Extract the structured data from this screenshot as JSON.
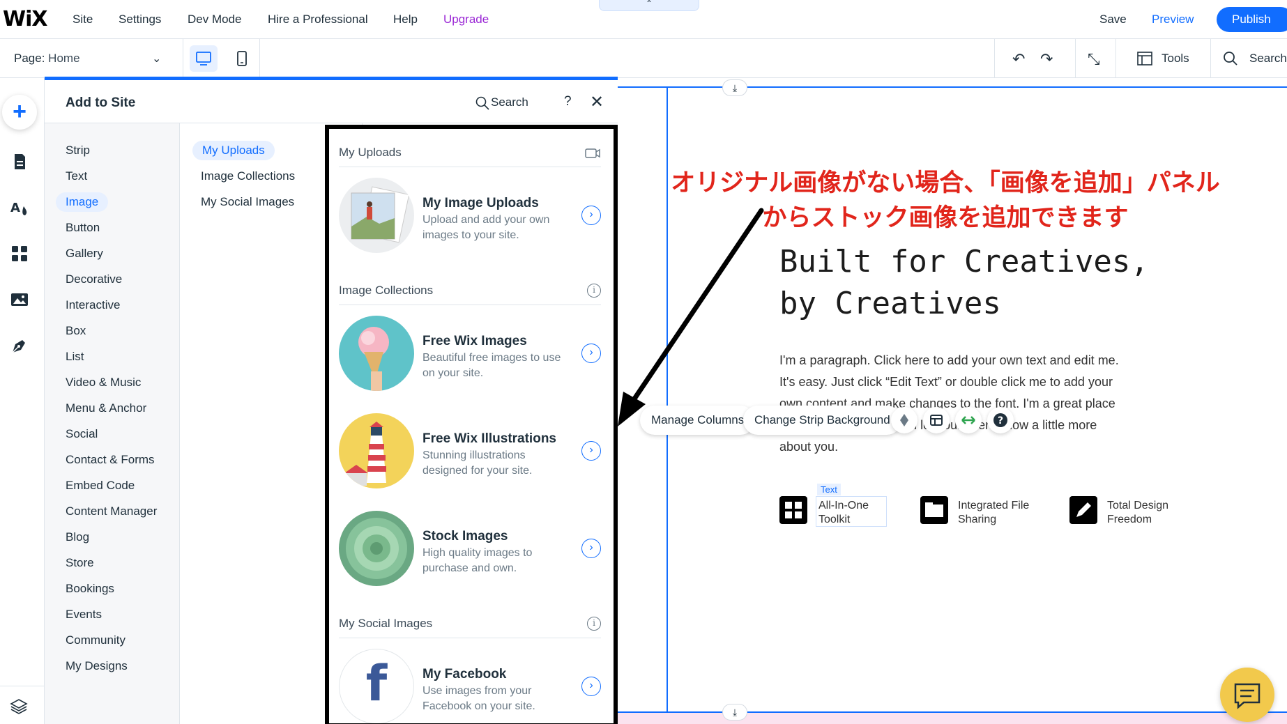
{
  "topbar": {
    "logo": "WiX",
    "nav": [
      {
        "label": "Site"
      },
      {
        "label": "Settings"
      },
      {
        "label": "Dev Mode"
      },
      {
        "label": "Hire a Professional"
      },
      {
        "label": "Help"
      },
      {
        "label": "Upgrade"
      }
    ],
    "collapse_glyph": "⌃",
    "save_label": "Save",
    "preview_label": "Preview",
    "publish_label": "Publish",
    "accent_color": "#116dff",
    "upgrade_color": "#9a27d5"
  },
  "subbar": {
    "page_prefix": "Page:",
    "page_value": "Home",
    "page_chevron": "⌄",
    "undo_glyph": "↶",
    "redo_glyph": "↷",
    "zoom_glyph": "⤡",
    "tools_label": "Tools",
    "search_label": "Search"
  },
  "panel": {
    "title": "Add to Site",
    "search_label": "Search",
    "help_glyph": "?",
    "close_glyph": "✕",
    "categories": [
      "Strip",
      "Text",
      "Image",
      "Button",
      "Gallery",
      "Decorative",
      "Interactive",
      "Box",
      "List",
      "Video & Music",
      "Menu & Anchor",
      "Social",
      "Contact & Forms",
      "Embed Code",
      "Content Manager",
      "Blog",
      "Store",
      "Bookings",
      "Events",
      "Community",
      "My Designs"
    ],
    "active_category": "Image",
    "subcategories": [
      "My Uploads",
      "Image Collections",
      "My Social Images"
    ],
    "sections": {
      "uploads_header": "My Uploads",
      "collections_header": "Image Collections",
      "social_header": "My Social Images",
      "info_glyph": "i"
    },
    "items": [
      {
        "title": "My Image Uploads",
        "desc": "Upload and add your own images to your site."
      },
      {
        "title": "Free Wix Images",
        "desc": "Beautiful free images to use on your site."
      },
      {
        "title": "Free Wix Illustrations",
        "desc": "Stunning illustrations designed for your site."
      },
      {
        "title": "Stock Images",
        "desc": "High quality images to purchase and own."
      },
      {
        "title": "My Facebook",
        "desc": "Use images from your Facebook on your site."
      }
    ],
    "go_glyph": "›",
    "facebook_letter": "f"
  },
  "canvas": {
    "annotation": "オリジナル画像がない場合、「画像を追加」パネルからストック画像を追加できます",
    "annotation_color": "#e1251b",
    "hero_line1": "Built for Creatives,",
    "hero_line2": "by Creatives",
    "paragraph": "I'm a paragraph. Click here to add your own text and edit me. It's easy. Just click “Edit Text” or double click me to add your own content and make changes to the font. I'm a great place for you to tell a story and let your users know a little more about you.",
    "manage_columns": "Manage Columns",
    "change_strip_bg": "Change Strip Background",
    "text_tag": "Text",
    "features": [
      "All-In-One Toolkit",
      "Integrated File Sharing",
      "Total Design Freedom"
    ],
    "anchor_glyph": "⤓"
  }
}
